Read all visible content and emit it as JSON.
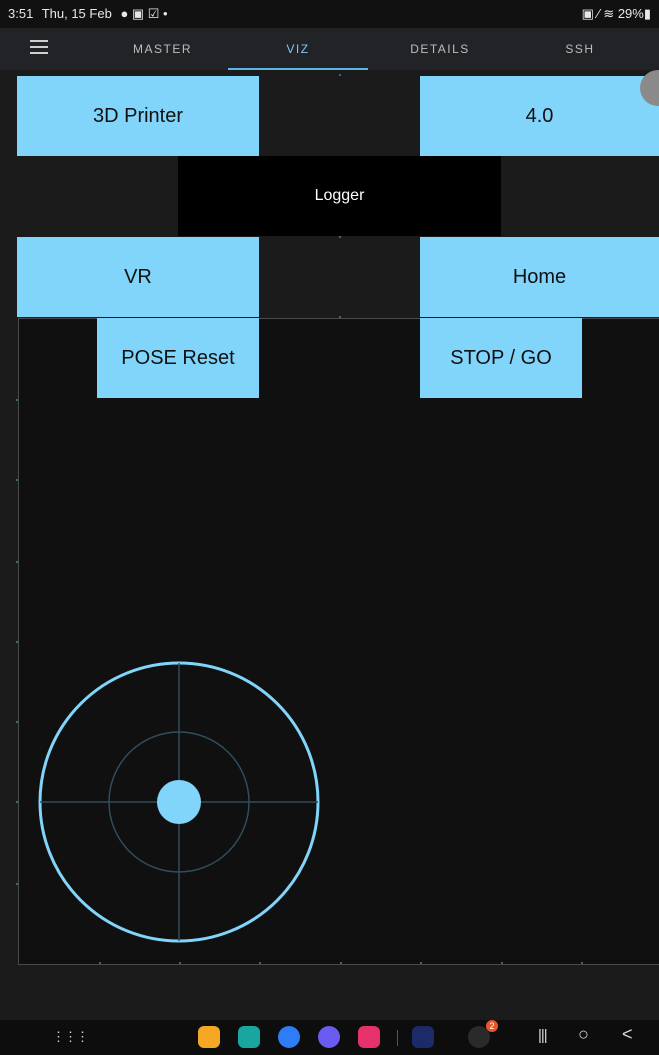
{
  "status": {
    "time": "3:51",
    "date": "Thu, 15 Feb",
    "icons": "● ▣ ☑ •",
    "right": "▣ ⁄ ≋ 29%▮"
  },
  "tabs": [
    {
      "label": "MASTER"
    },
    {
      "label": "VIZ"
    },
    {
      "label": "DETAILS"
    },
    {
      "label": "SSH"
    }
  ],
  "buttons": {
    "printer": "3D Printer",
    "version": "4.0",
    "logger": "Logger",
    "vr": "VR",
    "home": "Home",
    "pose_reset": "POSE Reset",
    "stop_go": "STOP / GO"
  },
  "colors": {
    "accent": "#81d4fa",
    "tab_active": "#7ec8f0",
    "joystick": "#81d4fa"
  },
  "navbar": {
    "apps_glyph": "⋮⋮⋮",
    "recents_glyph": "|||",
    "home_glyph": "○",
    "back_glyph": "<",
    "store_badge": "2"
  }
}
